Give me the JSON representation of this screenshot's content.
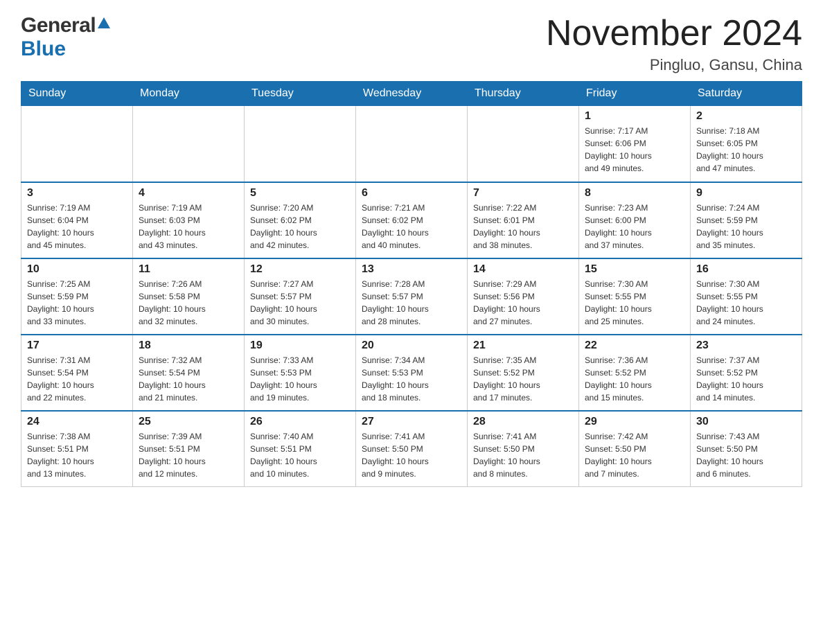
{
  "header": {
    "logo_general": "General",
    "logo_blue": "Blue",
    "month_title": "November 2024",
    "location": "Pingluo, Gansu, China"
  },
  "weekdays": [
    "Sunday",
    "Monday",
    "Tuesday",
    "Wednesday",
    "Thursday",
    "Friday",
    "Saturday"
  ],
  "weeks": [
    [
      {
        "day": "",
        "info": ""
      },
      {
        "day": "",
        "info": ""
      },
      {
        "day": "",
        "info": ""
      },
      {
        "day": "",
        "info": ""
      },
      {
        "day": "",
        "info": ""
      },
      {
        "day": "1",
        "info": "Sunrise: 7:17 AM\nSunset: 6:06 PM\nDaylight: 10 hours\nand 49 minutes."
      },
      {
        "day": "2",
        "info": "Sunrise: 7:18 AM\nSunset: 6:05 PM\nDaylight: 10 hours\nand 47 minutes."
      }
    ],
    [
      {
        "day": "3",
        "info": "Sunrise: 7:19 AM\nSunset: 6:04 PM\nDaylight: 10 hours\nand 45 minutes."
      },
      {
        "day": "4",
        "info": "Sunrise: 7:19 AM\nSunset: 6:03 PM\nDaylight: 10 hours\nand 43 minutes."
      },
      {
        "day": "5",
        "info": "Sunrise: 7:20 AM\nSunset: 6:02 PM\nDaylight: 10 hours\nand 42 minutes."
      },
      {
        "day": "6",
        "info": "Sunrise: 7:21 AM\nSunset: 6:02 PM\nDaylight: 10 hours\nand 40 minutes."
      },
      {
        "day": "7",
        "info": "Sunrise: 7:22 AM\nSunset: 6:01 PM\nDaylight: 10 hours\nand 38 minutes."
      },
      {
        "day": "8",
        "info": "Sunrise: 7:23 AM\nSunset: 6:00 PM\nDaylight: 10 hours\nand 37 minutes."
      },
      {
        "day": "9",
        "info": "Sunrise: 7:24 AM\nSunset: 5:59 PM\nDaylight: 10 hours\nand 35 minutes."
      }
    ],
    [
      {
        "day": "10",
        "info": "Sunrise: 7:25 AM\nSunset: 5:59 PM\nDaylight: 10 hours\nand 33 minutes."
      },
      {
        "day": "11",
        "info": "Sunrise: 7:26 AM\nSunset: 5:58 PM\nDaylight: 10 hours\nand 32 minutes."
      },
      {
        "day": "12",
        "info": "Sunrise: 7:27 AM\nSunset: 5:57 PM\nDaylight: 10 hours\nand 30 minutes."
      },
      {
        "day": "13",
        "info": "Sunrise: 7:28 AM\nSunset: 5:57 PM\nDaylight: 10 hours\nand 28 minutes."
      },
      {
        "day": "14",
        "info": "Sunrise: 7:29 AM\nSunset: 5:56 PM\nDaylight: 10 hours\nand 27 minutes."
      },
      {
        "day": "15",
        "info": "Sunrise: 7:30 AM\nSunset: 5:55 PM\nDaylight: 10 hours\nand 25 minutes."
      },
      {
        "day": "16",
        "info": "Sunrise: 7:30 AM\nSunset: 5:55 PM\nDaylight: 10 hours\nand 24 minutes."
      }
    ],
    [
      {
        "day": "17",
        "info": "Sunrise: 7:31 AM\nSunset: 5:54 PM\nDaylight: 10 hours\nand 22 minutes."
      },
      {
        "day": "18",
        "info": "Sunrise: 7:32 AM\nSunset: 5:54 PM\nDaylight: 10 hours\nand 21 minutes."
      },
      {
        "day": "19",
        "info": "Sunrise: 7:33 AM\nSunset: 5:53 PM\nDaylight: 10 hours\nand 19 minutes."
      },
      {
        "day": "20",
        "info": "Sunrise: 7:34 AM\nSunset: 5:53 PM\nDaylight: 10 hours\nand 18 minutes."
      },
      {
        "day": "21",
        "info": "Sunrise: 7:35 AM\nSunset: 5:52 PM\nDaylight: 10 hours\nand 17 minutes."
      },
      {
        "day": "22",
        "info": "Sunrise: 7:36 AM\nSunset: 5:52 PM\nDaylight: 10 hours\nand 15 minutes."
      },
      {
        "day": "23",
        "info": "Sunrise: 7:37 AM\nSunset: 5:52 PM\nDaylight: 10 hours\nand 14 minutes."
      }
    ],
    [
      {
        "day": "24",
        "info": "Sunrise: 7:38 AM\nSunset: 5:51 PM\nDaylight: 10 hours\nand 13 minutes."
      },
      {
        "day": "25",
        "info": "Sunrise: 7:39 AM\nSunset: 5:51 PM\nDaylight: 10 hours\nand 12 minutes."
      },
      {
        "day": "26",
        "info": "Sunrise: 7:40 AM\nSunset: 5:51 PM\nDaylight: 10 hours\nand 10 minutes."
      },
      {
        "day": "27",
        "info": "Sunrise: 7:41 AM\nSunset: 5:50 PM\nDaylight: 10 hours\nand 9 minutes."
      },
      {
        "day": "28",
        "info": "Sunrise: 7:41 AM\nSunset: 5:50 PM\nDaylight: 10 hours\nand 8 minutes."
      },
      {
        "day": "29",
        "info": "Sunrise: 7:42 AM\nSunset: 5:50 PM\nDaylight: 10 hours\nand 7 minutes."
      },
      {
        "day": "30",
        "info": "Sunrise: 7:43 AM\nSunset: 5:50 PM\nDaylight: 10 hours\nand 6 minutes."
      }
    ]
  ]
}
